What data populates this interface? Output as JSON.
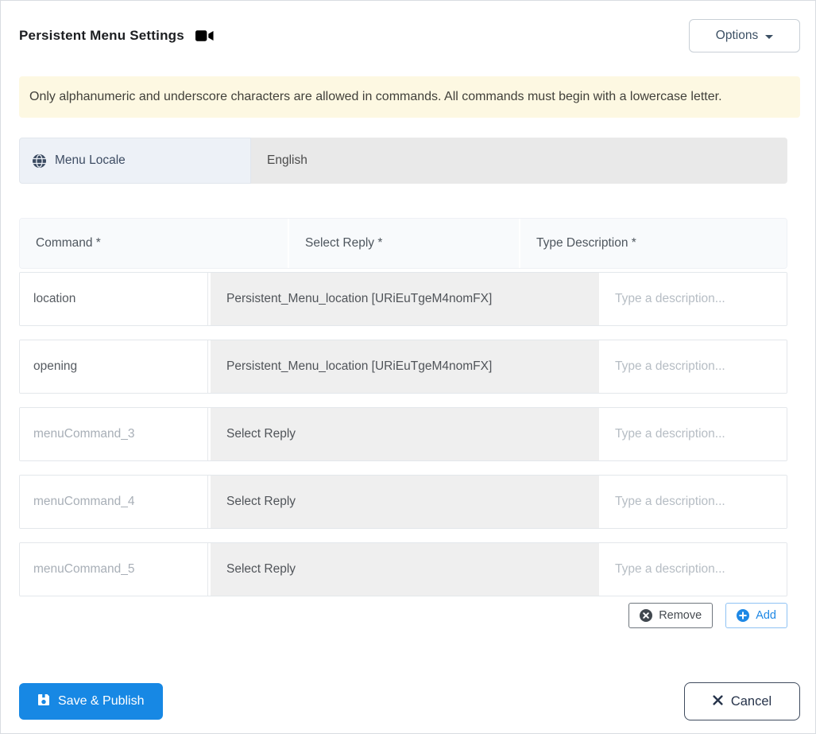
{
  "header": {
    "title": "Persistent Menu Settings",
    "options_label": "Options"
  },
  "banner": {
    "text": "Only alphanumeric and underscore characters are allowed in commands. All commands must begin with a lowercase letter."
  },
  "locale": {
    "label": "Menu Locale",
    "value": "English"
  },
  "table": {
    "headers": {
      "command": "Command *",
      "reply": "Select Reply *",
      "description": "Type Description *"
    },
    "description_placeholder": "Type a description...",
    "rows": [
      {
        "command_value": "location",
        "reply": "Persistent_Menu_location [URiEuTgeM4nomFX]"
      },
      {
        "command_value": "opening",
        "reply": "Persistent_Menu_location [URiEuTgeM4nomFX]"
      },
      {
        "command_placeholder": "menuCommand_3",
        "reply": "Select Reply"
      },
      {
        "command_placeholder": "menuCommand_4",
        "reply": "Select Reply"
      },
      {
        "command_placeholder": "menuCommand_5",
        "reply": "Select Reply"
      }
    ]
  },
  "actions": {
    "remove_label": "Remove",
    "add_label": "Add"
  },
  "footer": {
    "save_label": "Save & Publish",
    "cancel_label": "Cancel"
  },
  "icons": {
    "title_icon": "video-camera-icon",
    "locale_icon": "globe-icon",
    "options_caret": "caret-down-icon",
    "remove_icon": "circle-x-icon",
    "add_icon": "circle-plus-icon",
    "save_icon": "floppy-disk-icon",
    "cancel_icon": "x-icon"
  },
  "colors": {
    "banner_bg": "#fdf8e2",
    "save_blue": "#1788e4",
    "add_blue": "#1e88e5",
    "locale_label_bg": "#edf1f7",
    "locale_value_bg": "#e9e9e9",
    "table_head_bg": "#f8fafc",
    "reply_cell_bg": "#efefef"
  }
}
